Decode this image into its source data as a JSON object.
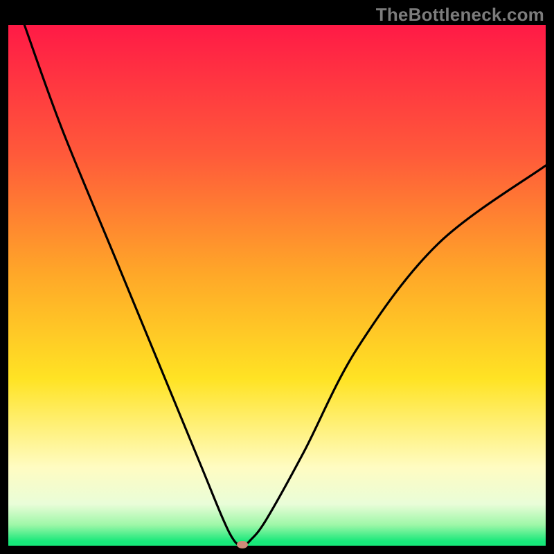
{
  "watermark": "TheBottleneck.com",
  "chart_data": {
    "type": "line",
    "title": "",
    "xlabel": "",
    "ylabel": "",
    "xlim": [
      0,
      100
    ],
    "ylim": [
      0,
      100
    ],
    "series": [
      {
        "name": "bottleneck-curve",
        "x": [
          3,
          10,
          20,
          30,
          36,
          40,
          42,
          43.5,
          45,
          48,
          55,
          65,
          80,
          100
        ],
        "values": [
          100,
          80,
          55,
          30,
          15,
          5,
          1,
          0,
          1,
          5,
          18,
          38,
          58,
          73
        ]
      }
    ],
    "marker": {
      "x": 43.5,
      "y": 0
    },
    "gradient_bands": [
      {
        "stop": 0,
        "color": "#ff1a46"
      },
      {
        "stop": 0.25,
        "color": "#ff5a3a"
      },
      {
        "stop": 0.48,
        "color": "#ffa828"
      },
      {
        "stop": 0.68,
        "color": "#ffe324"
      },
      {
        "stop": 0.85,
        "color": "#fffcc2"
      },
      {
        "stop": 0.92,
        "color": "#e9fdd8"
      },
      {
        "stop": 0.96,
        "color": "#9ef7a8"
      },
      {
        "stop": 1.0,
        "color": "#17e87a"
      }
    ]
  }
}
